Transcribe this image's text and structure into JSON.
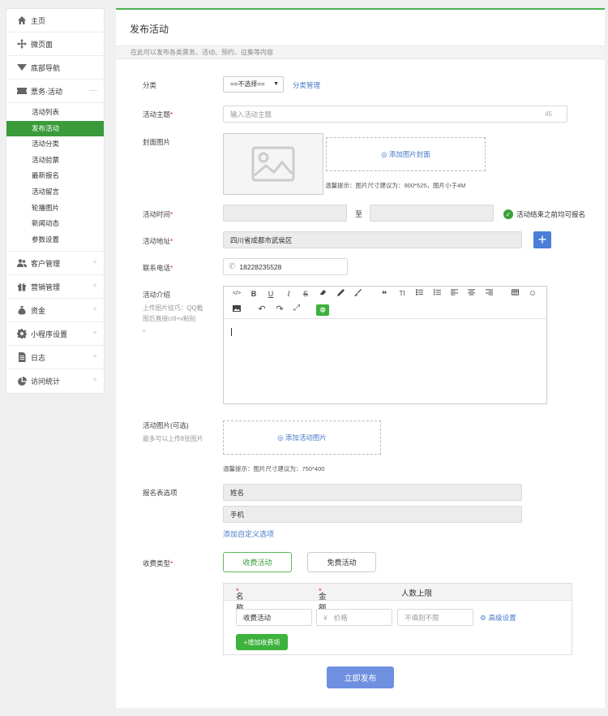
{
  "sidebar": {
    "items": [
      {
        "label": "主页",
        "icon": "home-icon"
      },
      {
        "label": "微页面",
        "icon": "move-icon"
      },
      {
        "label": "底部导航",
        "icon": "triangle-down-icon"
      },
      {
        "label": "票务·活动",
        "icon": "ticket-icon",
        "expanded": true
      }
    ],
    "subitems": [
      "活动列表",
      "发布活动",
      "活动分类",
      "活动验票",
      "最新报名",
      "活动留言",
      "轮播图片",
      "新闻动态",
      "参数设置"
    ],
    "active_subitem": "发布活动",
    "more_items": [
      {
        "label": "客户管理",
        "icon": "users-icon"
      },
      {
        "label": "营销管理",
        "icon": "gift-icon"
      },
      {
        "label": "资金",
        "icon": "moneybag-icon"
      },
      {
        "label": "小程序设置",
        "icon": "gear-icon"
      },
      {
        "label": "日志",
        "icon": "document-icon"
      },
      {
        "label": "访问统计",
        "icon": "pie-icon"
      }
    ],
    "minus_sign": "—",
    "plus_sign": "+"
  },
  "main": {
    "title": "发布活动",
    "tip": "在此可以发布各类票务、活动、预约、征集等内容"
  },
  "form": {
    "category": {
      "label": "分类",
      "select_value": "==不选择==",
      "manage_link": "分类管理"
    },
    "subject": {
      "label": "活动主题",
      "placeholder": "输入活动主题",
      "counter": "45"
    },
    "cover": {
      "label": "封面图片",
      "add_text": "添加图片封面",
      "hint": "温馨提示：图片尺寸建议为：900*525，图片小于4M"
    },
    "time": {
      "label": "活动时间",
      "separator": "至",
      "check_label": "活动结束之前均可报名"
    },
    "address": {
      "label": "活动地址",
      "value": "四川省成都市武侯区",
      "add_button": "+"
    },
    "phone": {
      "label": "联系电话",
      "value": "18228235528"
    },
    "intro": {
      "label": "活动介绍",
      "sub": [
        "上传图片技巧：QQ截",
        "图后直接crtl+v粘贴",
        "。"
      ]
    },
    "toolbar": [
      "</>",
      "B",
      "U",
      "I",
      "S",
      "eraser",
      "pen",
      "brush",
      "❝",
      "TI",
      "list-ul",
      "list-ol",
      "align-left",
      "align-center",
      "align-right",
      "table",
      "☺",
      "image",
      "undo",
      "redo",
      "fullscreen",
      "wechat"
    ],
    "images": {
      "label": "活动图片(可选)",
      "sub": "最多可以上传8张图片",
      "add_text": "添加活动图片",
      "hint": "温馨提示：图片尺寸建议为：750*400"
    },
    "signup": {
      "label": "报名表选项",
      "field1": "姓名",
      "field2": "手机",
      "add_link": "添加自定义选项"
    },
    "fee": {
      "label": "收费类型",
      "option_paid": "收费活动",
      "option_free": "免费活动",
      "columns": [
        "名称",
        "金额",
        "人数上限"
      ],
      "row": {
        "name": "收费活动",
        "price_prefix": "¥",
        "price_placeholder": "价格",
        "limit_placeholder": "不填则不限",
        "advanced": "高级设置"
      },
      "add_button": "+增加收费项"
    },
    "submit": "立即发布"
  },
  "colors": {
    "accent_green": "#3a9b3a",
    "link_blue": "#4a78c8",
    "submit_blue": "#6f8fe0"
  }
}
